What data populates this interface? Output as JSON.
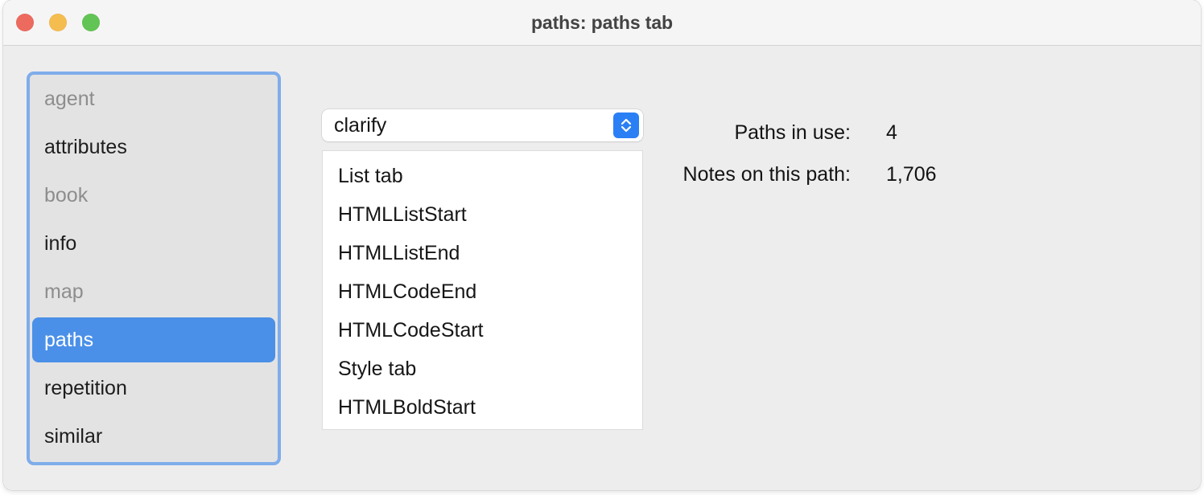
{
  "window": {
    "title": "paths: paths tab",
    "traffic_lights": [
      {
        "name": "close",
        "color": "#ed6a5e"
      },
      {
        "name": "minimize",
        "color": "#f5bd4f"
      },
      {
        "name": "maximize",
        "color": "#61c454"
      }
    ]
  },
  "sidebar": {
    "items": [
      {
        "label": "agent",
        "state": "dim"
      },
      {
        "label": "attributes",
        "state": "normal"
      },
      {
        "label": "book",
        "state": "dim"
      },
      {
        "label": "info",
        "state": "normal"
      },
      {
        "label": "map",
        "state": "dim"
      },
      {
        "label": "paths",
        "state": "selected"
      },
      {
        "label": "repetition",
        "state": "normal"
      },
      {
        "label": "similar",
        "state": "normal"
      }
    ],
    "selection_color": "#4a90e8",
    "focus_ring_color": "#7fadea"
  },
  "popup_button": {
    "value": "clarify",
    "icon": "chevron-up-down-icon",
    "accent": "#2b7ff5"
  },
  "listbox": {
    "rows": [
      "List tab",
      "HTMLListStart",
      "HTMLListEnd",
      "HTMLCodeEnd",
      "HTMLCodeStart",
      "Style tab",
      "HTMLBoldStart"
    ]
  },
  "stats": {
    "rows": [
      {
        "label": "Paths in use:",
        "value": "4"
      },
      {
        "label": "Notes on this path:",
        "value": "1,706"
      }
    ]
  }
}
